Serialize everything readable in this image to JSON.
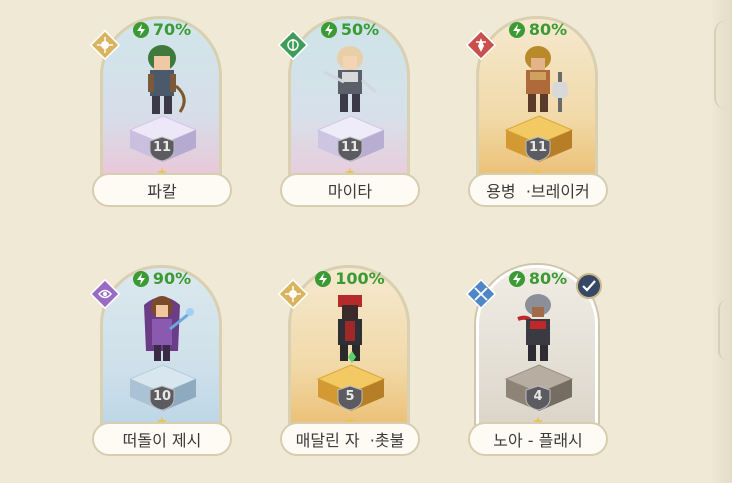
{
  "heroes": [
    {
      "name": "파칼",
      "energy": "70%",
      "level": "11",
      "element": "light-element-icon",
      "colors": {
        "top": "#cfe4e8",
        "bottom": "#f2bfd3",
        "pedestal": "#e7e3f5"
      }
    },
    {
      "name": "마이타",
      "energy": "50%",
      "level": "11",
      "element": "earth-element-icon",
      "colors": {
        "top": "#c9e2e6",
        "bottom": "#efc6d6",
        "pedestal": "#e8e6f6"
      }
    },
    {
      "name": "용병  ·브레이커",
      "energy": "80%",
      "level": "11",
      "element": "fire-element-icon",
      "colors": {
        "top": "#f4e3c2",
        "bottom": "#efc176",
        "pedestal": "#e9b94b"
      }
    },
    {
      "name": "떠돌이 제시",
      "energy": "90%",
      "level": "10",
      "element": "dark-element-icon",
      "colors": {
        "top": "#d6e5ec",
        "bottom": "#b8d5e6",
        "pedestal": "#c7dbe8"
      }
    },
    {
      "name": "매달린 자  ·촛불",
      "energy": "100%",
      "level": "5",
      "element": "light-element-icon",
      "colors": {
        "top": "#f4e3c2",
        "bottom": "#efc176",
        "pedestal": "#e9b94b"
      }
    },
    {
      "name": "노아 - 플래시",
      "energy": "80%",
      "level": "4",
      "element": "water-element-icon",
      "colors": {
        "top": "#e9e4da",
        "bottom": "#d7d1c5",
        "pedestal": "#a99f93"
      },
      "selected": true
    }
  ]
}
